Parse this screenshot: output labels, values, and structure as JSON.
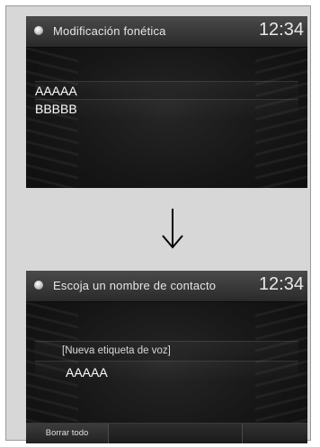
{
  "top_screen": {
    "title": "Modificación fonética",
    "clock": "12:34",
    "lines": [
      "AAAAA",
      "BBBBB"
    ]
  },
  "bottom_screen": {
    "title": "Escoja un nombre de contacto",
    "clock": "12:34",
    "label": "[Nueva etiqueta de voz]",
    "value": "AAAAA",
    "clear_button": "Borrar todo"
  },
  "arrow_icon": "down-arrow-icon"
}
